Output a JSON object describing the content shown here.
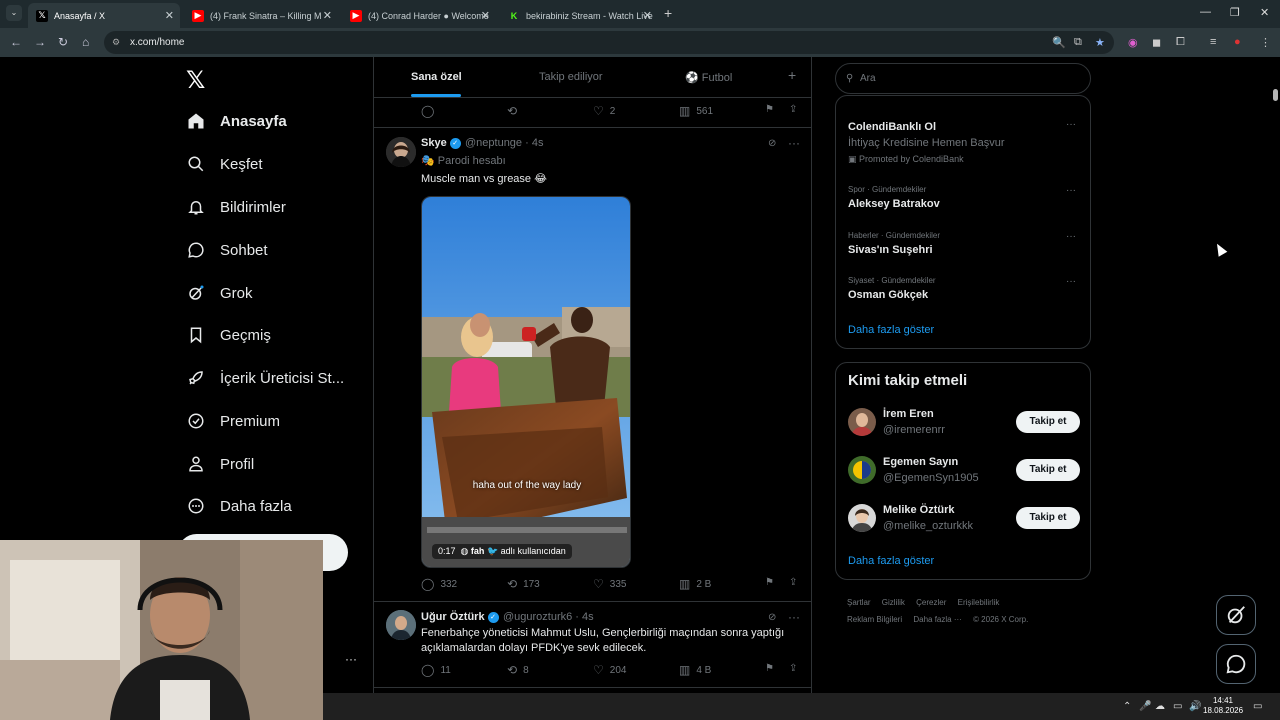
{
  "browser": {
    "tabs": [
      {
        "title": "Anasayfa / X",
        "favicon": "x-logo",
        "active": true
      },
      {
        "title": "(4) Frank Sinatra – Killing M",
        "favicon": "youtube",
        "active": false
      },
      {
        "title": "(4) Conrad Harder ● Welcome",
        "favicon": "youtube",
        "active": false
      },
      {
        "title": "bekirabiniz Stream - Watch Live",
        "favicon": "kick",
        "active": false
      }
    ],
    "url": "x.com/home",
    "new_tab": "+"
  },
  "left_nav": {
    "items": [
      {
        "label": "Anasayfa",
        "icon": "home-icon"
      },
      {
        "label": "Keşfet",
        "icon": "search-icon"
      },
      {
        "label": "Bildirimler",
        "icon": "bell-icon"
      },
      {
        "label": "Sohbet",
        "icon": "chat-icon"
      },
      {
        "label": "Grok",
        "icon": "grok-icon"
      },
      {
        "label": "Geçmiş",
        "icon": "bookmark-icon"
      },
      {
        "label": "İçerik Üreticisi St...",
        "icon": "rocket-icon"
      },
      {
        "label": "Premium",
        "icon": "premium-icon"
      },
      {
        "label": "Profil",
        "icon": "person-icon"
      },
      {
        "label": "Daha fazla",
        "icon": "more-circle-icon"
      }
    ],
    "more_dots": "···"
  },
  "feed": {
    "tabs": [
      "Sana özel",
      "Takip ediliyor",
      "Futbol"
    ],
    "add_tab": "+",
    "prev_post_actions": {
      "replies": "",
      "reposts": "",
      "likes": "2",
      "views": "561"
    },
    "post1": {
      "name": "Skye",
      "handle": "@neptunge · 4s",
      "parody": "Parodi hesabı",
      "text": "Muscle man vs grease 😂",
      "video_caption": "haha out of the way lady",
      "video_time": "0:17",
      "video_attr": "fah",
      "video_source": "adlı kullanıcıdan",
      "actions": {
        "replies": "332",
        "reposts": "173",
        "likes": "335",
        "views": "2 B"
      }
    },
    "post2": {
      "name": "Uğur Öztürk",
      "handle": "@ugurozturk6 · 4s",
      "text": "Fenerbahçe yöneticisi Mahmut Uslu, Gençlerbirliği maçından sonra yaptığı açıklamalardan dolayı PFDK'ye sevk edilecek.",
      "actions": {
        "replies": "11",
        "reposts": "8",
        "likes": "204",
        "views": "4 B"
      }
    }
  },
  "sidebar": {
    "search_placeholder": "Ara",
    "trends": {
      "promoted_title": "ColendiBanklı Ol",
      "promoted_sub": "İhtiyaç Kredisine Hemen Başvur",
      "promoted_by": "Promoted by ColendiBank",
      "items": [
        {
          "meta": "Spor · Gündemdekiler",
          "title": "Aleksey Batrakov"
        },
        {
          "meta": "Haberler · Gündemdekiler",
          "title": "Sivas'ın Suşehri"
        },
        {
          "meta": "Siyaset · Gündemdekiler",
          "title": "Osman Gökçek"
        }
      ],
      "show_more": "Daha fazla göster"
    },
    "who_to_follow": {
      "title": "Kimi takip etmeli",
      "users": [
        {
          "name": "İrem Eren",
          "handle": "@iremerenrr",
          "button": "Takip et"
        },
        {
          "name": "Egemen Sayın",
          "handle": "@EgemenSyn1905",
          "button": "Takip et"
        },
        {
          "name": "Melike Öztürk",
          "handle": "@melike_ozturkkk",
          "button": "Takip et"
        }
      ],
      "show_more": "Daha fazla göster"
    },
    "footer": [
      "Şartlar",
      "Gizlilik",
      "Çerezler",
      "Erişilebilirlik",
      "Reklam Bilgileri",
      "Daha fazla ···",
      "© 2026 X Corp."
    ]
  },
  "taskbar": {
    "time": "14:41",
    "date": "18.08.2026"
  },
  "colors": {
    "accent": "#1d9bf0",
    "border": "#2f3336",
    "muted": "#71767b"
  }
}
